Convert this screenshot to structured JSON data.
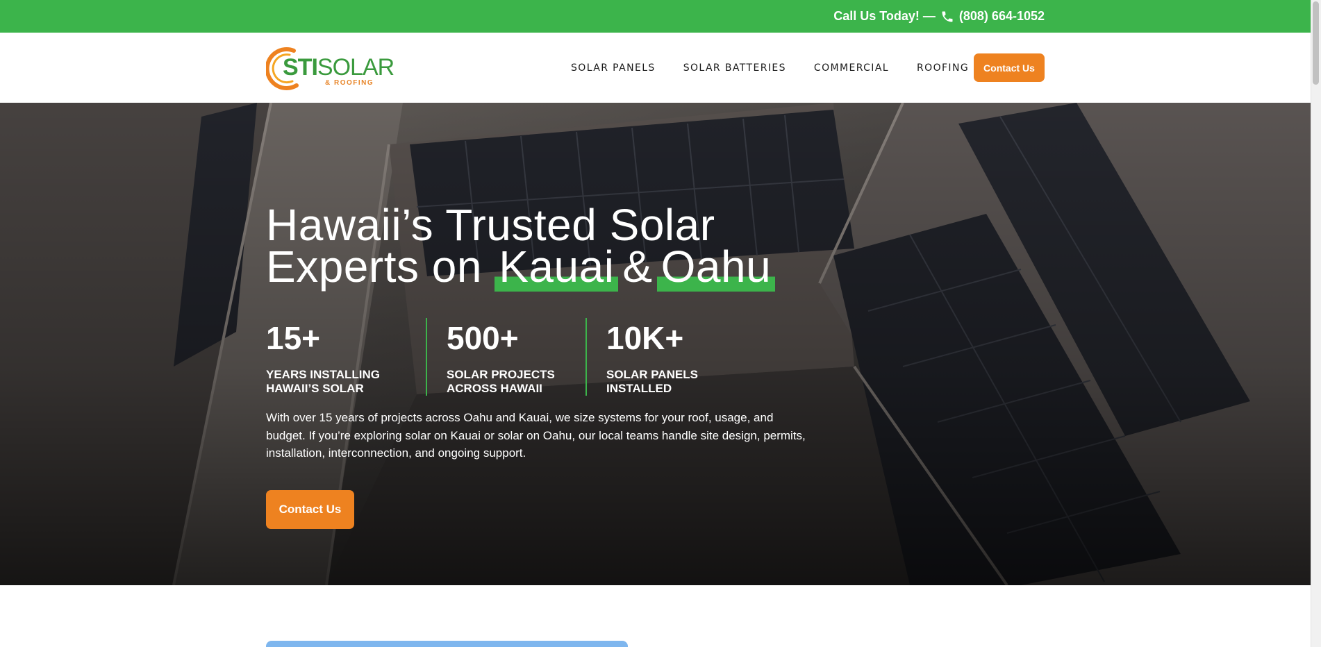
{
  "topbar": {
    "call_text": "Call Us Today! —",
    "phone": "(808) 664-1052"
  },
  "logo": {
    "sti": "STI",
    "solar": "SOLAR",
    "sub": "& ROOFING"
  },
  "nav": {
    "items": [
      {
        "label": "SOLAR PANELS"
      },
      {
        "label": "SOLAR BATTERIES"
      },
      {
        "label": "COMMERCIAL"
      },
      {
        "label": "ROOFING"
      }
    ],
    "contact_label": "Contact Us"
  },
  "hero": {
    "title_line1": "Hawaii’s Trusted Solar",
    "title_prefix": "Experts on",
    "title_kauai": "Kauai",
    "title_amp": "&",
    "title_oahu": "Oahu",
    "stats": [
      {
        "number": "15+",
        "label_line1": "YEARS INSTALLING",
        "label_line2": "HAWAII’S SOLAR"
      },
      {
        "number": "500+",
        "label_line1": "SOLAR PROJECTS",
        "label_line2": "ACROSS HAWAII"
      },
      {
        "number": "10K+",
        "label_line1": "SOLAR PANELS",
        "label_line2": "INSTALLED"
      }
    ],
    "description": "With over 15 years of projects across Oahu and Kauai, we size systems for your roof, usage, and budget. If you’re exploring solar on Kauai or solar on Oahu, our local teams handle site design, permits, installation, interconnection, and ongoing support.",
    "cta_label": "Contact Us"
  },
  "colors": {
    "brand_green": "#3cb44b",
    "brand_orange": "#ee8220"
  },
  "icons": {
    "phone": "phone-icon"
  }
}
